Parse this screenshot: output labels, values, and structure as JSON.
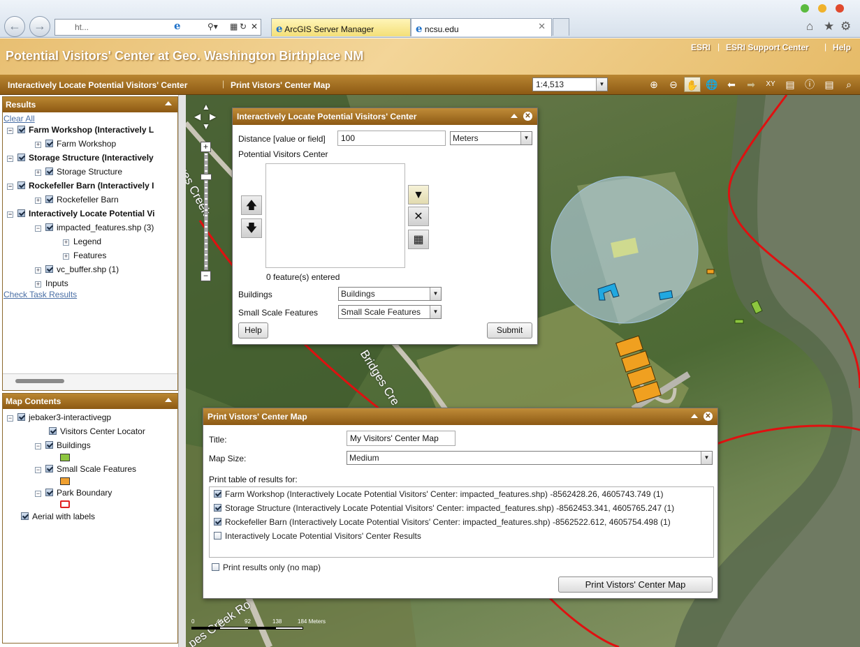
{
  "browser": {
    "address_text": "ht...",
    "tabs": [
      {
        "label": "ArcGIS Server Manager"
      },
      {
        "label": "ncsu.edu"
      }
    ]
  },
  "header": {
    "title": "Potential Visitors' Center at Geo. Washington Birthplace NM",
    "links": [
      "ESRI",
      "ESRI Support Center",
      "Help"
    ]
  },
  "taskbar": {
    "tasks": [
      "Interactively Locate Potential Visitors' Center",
      "Print Vistors' Center Map"
    ],
    "scale_value": "1:4,513"
  },
  "results": {
    "title": "Results",
    "clear_all": "Clear All",
    "check_task_results": "Check Task Results",
    "items": [
      {
        "label": "Farm Workshop (Interactively L",
        "child": "Farm Workshop"
      },
      {
        "label": "Storage Structure (Interactively",
        "child": "Storage Structure"
      },
      {
        "label": "Rockefeller Barn (Interactively I",
        "child": "Rockefeller Barn"
      },
      {
        "label": "Interactively Locate Potential Vi"
      }
    ],
    "impacted": "impacted_features.shp (3)",
    "legend": "Legend",
    "features": "Features",
    "vc_buffer": "vc_buffer.shp (1)",
    "inputs": "Inputs"
  },
  "map_contents": {
    "title": "Map Contents",
    "root": "jebaker3-interactivegp",
    "layers": [
      "Visitors Center Locator",
      "Buildings",
      "Small Scale Features",
      "Park Boundary"
    ],
    "basemap": "Aerial with labels",
    "swatch_colors": {
      "buildings": "#8dc63f",
      "small_scale": "#f0a030",
      "park_boundary": "#e02020"
    }
  },
  "map": {
    "road_labels": [
      "Bridges Creek",
      "Bridges Cre",
      "dges Creek",
      "pes Creek Ro"
    ],
    "scale_ticks": [
      "0",
      "46",
      "92",
      "138",
      "184 Meters"
    ]
  },
  "locate_dialog": {
    "title": "Interactively Locate Potential Visitors' Center",
    "distance_label": "Distance [value or field]",
    "distance_value": "100",
    "units": "Meters",
    "pvc_label": "Potential Visitors Center",
    "features_entered": "0 feature(s) entered",
    "buildings_label": "Buildings",
    "buildings_value": "Buildings",
    "ssf_label": "Small Scale Features",
    "ssf_value": "Small Scale Features",
    "help": "Help",
    "submit": "Submit"
  },
  "print_dialog": {
    "title": "Print Vistors' Center Map",
    "title_label": "Title:",
    "title_value": "My Visitors' Center Map",
    "size_label": "Map Size:",
    "size_value": "Medium",
    "table_label": "Print table of results for:",
    "rows": [
      {
        "text": "Farm Workshop (Interactively Locate Potential Visitors' Center: impacted_features.shp) -8562428.26, 4605743.749 (1)",
        "checked": true
      },
      {
        "text": "Storage Structure (Interactively Locate Potential Visitors' Center: impacted_features.shp) -8562453.341, 4605765.247 (1)",
        "checked": true
      },
      {
        "text": "Rockefeller Barn (Interactively Locate Potential Visitors' Center: impacted_features.shp) -8562522.612, 4605754.498 (1)",
        "checked": true
      },
      {
        "text": "Interactively Locate Potential Visitors' Center Results",
        "checked": false
      }
    ],
    "results_only": "Print results only (no map)",
    "print_button": "Print Vistors' Center Map"
  }
}
